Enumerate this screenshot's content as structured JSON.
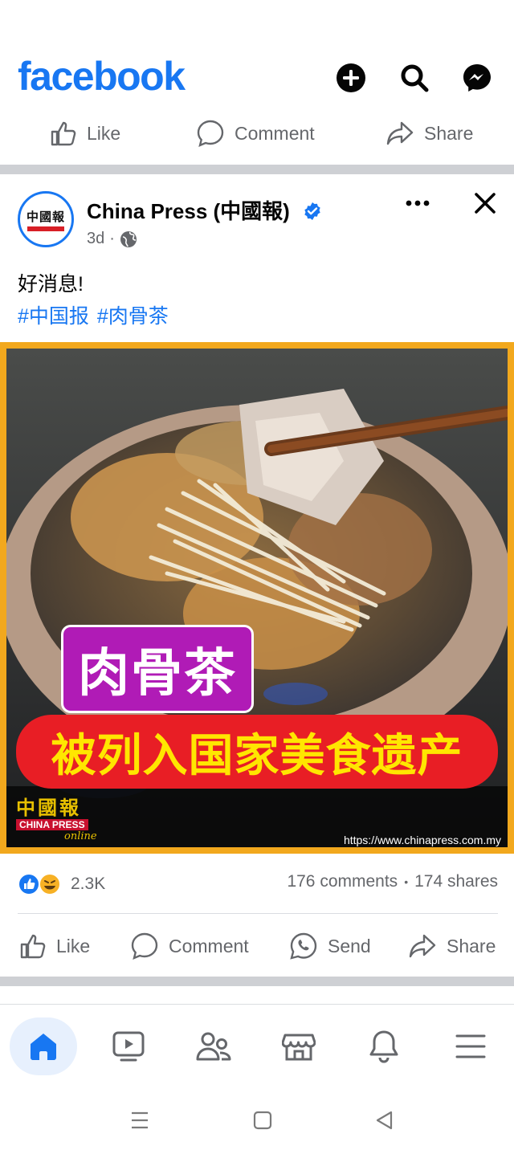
{
  "app": {
    "brand": "facebook"
  },
  "top_actions": {
    "like": "Like",
    "comment": "Comment",
    "share": "Share"
  },
  "post": {
    "author": "China Press (中國報)",
    "avatar_text": "中國報",
    "time": "3d",
    "dot": "·",
    "text": "好消息!",
    "hashtags": [
      "#中国报",
      "#肉骨茶"
    ],
    "image": {
      "title_main": "肉骨茶",
      "title_sub": "被列入国家美食遗产",
      "logo_cn": "中國報",
      "logo_en": "CHINA PRESS",
      "logo_sub": "online",
      "url": "https://www.chinapress.com.my"
    },
    "reactions_count": "2.3K",
    "comments": "176 comments",
    "stats_dot": "•",
    "shares": "174 shares"
  },
  "post_actions": {
    "like": "Like",
    "comment": "Comment",
    "send": "Send",
    "share": "Share"
  },
  "colors": {
    "brand": "#1877f2",
    "muted": "#65676b",
    "divider": "#ced0d4",
    "frame": "#f2a81d"
  }
}
